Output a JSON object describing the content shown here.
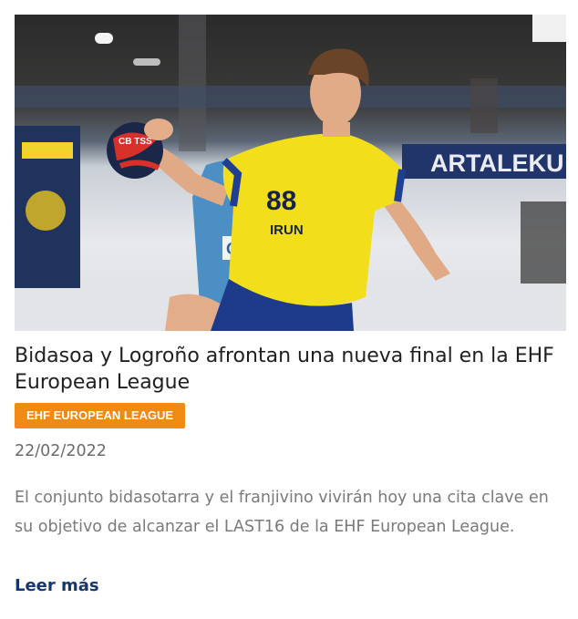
{
  "article": {
    "image": {
      "banner_text": "ARTALEKU",
      "sponsor_text": "OF",
      "ball_text": "CB TSS",
      "jersey_number": "88",
      "jersey_text": "IRUN"
    },
    "title": "Bidasoa y Logroño afrontan una nueva final en la EHF European League",
    "category": "EHF EUROPEAN LEAGUE",
    "date": "22/02/2022",
    "excerpt": "El conjunto bidasotarra y el franjivino vivirán hoy una cita clave en su objetivo de alcanzar el LAST16 de la EHF European League.",
    "read_more": "Leer más"
  },
  "colors": {
    "badge": "#ef8a14",
    "read_more": "#16366f",
    "jersey": "#f2de1b"
  }
}
